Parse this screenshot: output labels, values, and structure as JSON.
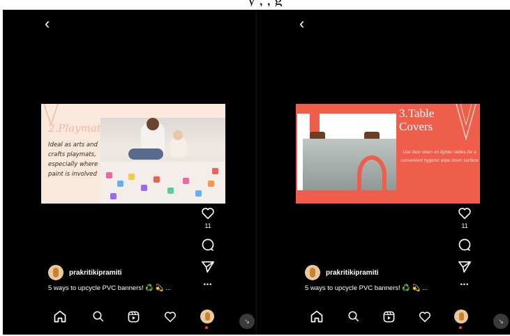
{
  "top_text": "y , , g",
  "screens": [
    {
      "post": {
        "title": "2.Playmats",
        "text": "Ideal as arts and crafts playmats, especially where paint is involved"
      },
      "likes": "11",
      "username": "prakritikipramiti",
      "caption": "5 ways to upcycle PVC banners! ♻️ 💫 ...",
      "more": "•••"
    },
    {
      "post": {
        "title_line1": "3.Table",
        "title_line2": "Covers",
        "text": "Use face down on lighter tables for a convenient hygenic wipe down surface"
      },
      "likes": "11",
      "username": "prakritikipramiti",
      "caption": "5 ways to upcycle PVC banners! ♻️ 💫 ...",
      "more": "•••"
    }
  ],
  "icons": [
    "back-icon",
    "heart-icon",
    "comment-icon",
    "send-icon",
    "more-icon",
    "home-icon",
    "search-icon",
    "reels-icon",
    "activity-icon",
    "profile-avatar",
    "minimize-icon"
  ],
  "colors": {
    "background": "#000000",
    "post1_bg": "#fbe8dc",
    "post2_bg": "#ef5d4b",
    "profile_dot": "#ff3b30"
  }
}
